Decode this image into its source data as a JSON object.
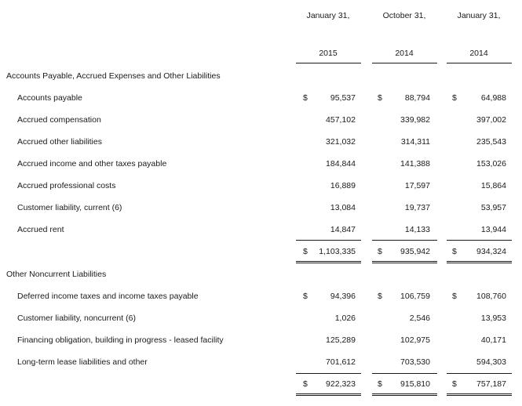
{
  "header": {
    "columns": [
      {
        "line1": "January 31,",
        "line2": "2015"
      },
      {
        "line1": "October 31,",
        "line2": "2014"
      },
      {
        "line1": "January 31,",
        "line2": "2014"
      }
    ]
  },
  "sections": [
    {
      "title": "Accounts Payable, Accrued Expenses and Other Liabilities",
      "rows": [
        {
          "label": "Accounts payable",
          "dollar": "$",
          "values": [
            "95,537",
            "88,794",
            "64,988"
          ]
        },
        {
          "label": "Accrued compensation",
          "dollar": "",
          "values": [
            "457,102",
            "339,982",
            "397,002"
          ]
        },
        {
          "label": "Accrued other liabilities",
          "dollar": "",
          "values": [
            "321,032",
            "314,311",
            "235,543"
          ]
        },
        {
          "label": "Accrued income and other taxes payable",
          "dollar": "",
          "values": [
            "184,844",
            "141,388",
            "153,026"
          ]
        },
        {
          "label": "Accrued professional costs",
          "dollar": "",
          "values": [
            "16,889",
            "17,597",
            "15,864"
          ]
        },
        {
          "label": "Customer liability, current (6)",
          "dollar": "",
          "values": [
            "13,084",
            "19,737",
            "53,957"
          ]
        },
        {
          "label": "Accrued rent",
          "dollar": "",
          "values": [
            "14,847",
            "14,133",
            "13,944"
          ]
        }
      ],
      "total": {
        "dollar": "$",
        "values": [
          "1,103,335",
          "935,942",
          "934,324"
        ]
      }
    },
    {
      "title": "Other Noncurrent Liabilities",
      "rows": [
        {
          "label": "Deferred income taxes and income taxes payable",
          "dollar": "$",
          "values": [
            "94,396",
            "106,759",
            "108,760"
          ]
        },
        {
          "label": "Customer liability, noncurrent (6)",
          "dollar": "",
          "values": [
            "1,026",
            "2,546",
            "13,953"
          ]
        },
        {
          "label": "Financing obligation, building in progress - leased facility",
          "dollar": "",
          "values": [
            "125,289",
            "102,975",
            "40,171"
          ]
        },
        {
          "label": "Long-term lease liabilities and other",
          "dollar": "",
          "values": [
            "701,612",
            "703,530",
            "594,303"
          ]
        }
      ],
      "total": {
        "dollar": "$",
        "values": [
          "922,323",
          "915,810",
          "757,187"
        ]
      }
    }
  ]
}
